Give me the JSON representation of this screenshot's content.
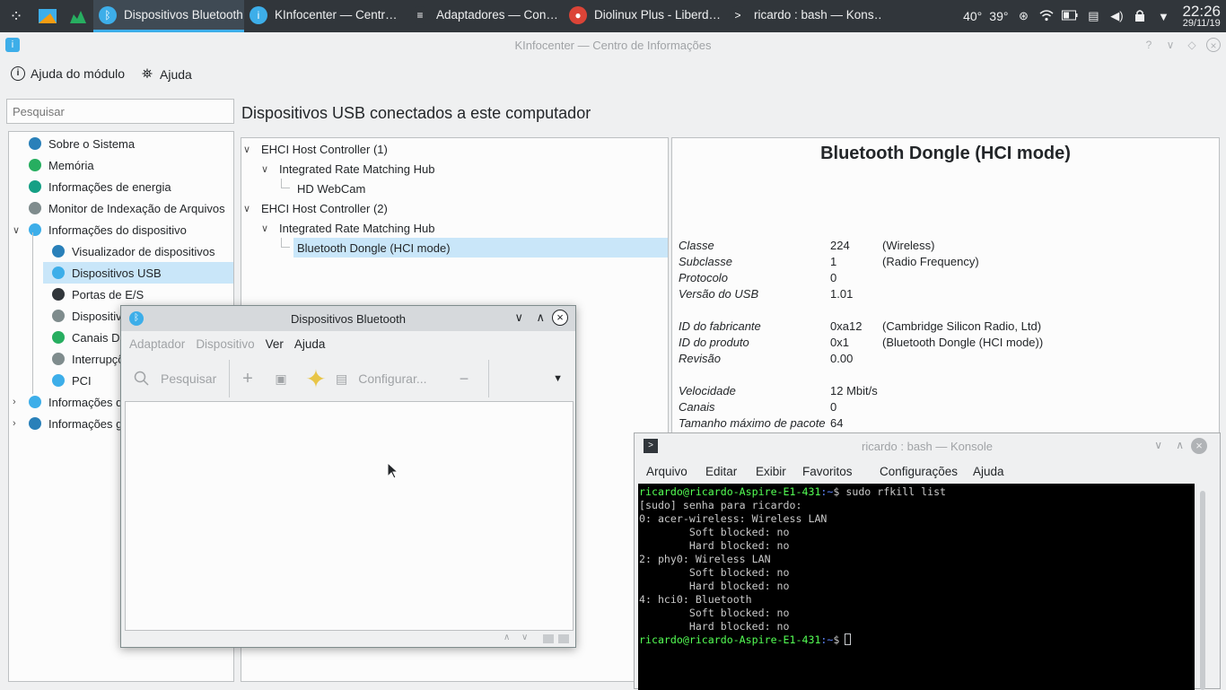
{
  "taskbar": {
    "tasks": [
      {
        "label": "Dispositivos Bluetooth",
        "icon": "bluetooth-icon",
        "active": true
      },
      {
        "label": "KInfocenter — Centr…",
        "icon": "kinfocenter-icon"
      },
      {
        "label": "Adaptadores — Con…",
        "icon": "settings-icon"
      },
      {
        "label": "Diolinux Plus - Liberd…",
        "icon": "chrome-icon"
      },
      {
        "label": "ricardo : bash — Kons…",
        "icon": "terminal-icon"
      }
    ],
    "temp1": "40°",
    "temp2": "39°",
    "time": "22:26",
    "date": "29/11/19"
  },
  "kinfo": {
    "title": "KInfocenter — Centro de Informações",
    "toolbar": {
      "module_help": "Ajuda do módulo",
      "help": "Ajuda"
    },
    "search_placeholder": "Pesquisar",
    "heading": "Dispositivos USB conectados a este computador",
    "sidebar": [
      {
        "label": "Sobre o Sistema",
        "color": "#2980b9"
      },
      {
        "label": "Memória",
        "color": "#27ae60"
      },
      {
        "label": "Informações de energia",
        "color": "#16a085"
      },
      {
        "label": "Monitor de Indexação de Arquivos",
        "color": "#7f8c8d"
      },
      {
        "label": "Informações do dispositivo",
        "color": "#3daee9"
      },
      {
        "label": "Visualizador de dispositivos",
        "color": "#2980b9"
      },
      {
        "label": "Dispositivos USB",
        "color": "#3daee9"
      },
      {
        "label": "Portas de E/S",
        "color": "#31363b"
      },
      {
        "label": "Dispositivo",
        "color": "#7f8c8d"
      },
      {
        "label": "Canais DM",
        "color": "#27ae60"
      },
      {
        "label": "Interrupçõ",
        "color": "#7f8c8d"
      },
      {
        "label": "PCI",
        "color": "#3daee9"
      },
      {
        "label": "Informações d",
        "color": "#3daee9"
      },
      {
        "label": "Informações g",
        "color": "#2980b9"
      }
    ],
    "usb_tree": [
      "EHCI Host Controller (1)",
      "Integrated Rate Matching Hub",
      "HD WebCam",
      "EHCI Host Controller (2)",
      "Integrated Rate Matching Hub",
      "Bluetooth Dongle (HCI mode)"
    ],
    "detail": {
      "title": "Bluetooth Dongle (HCI mode)",
      "rows": [
        {
          "k": "Classe",
          "v": "224",
          "x": "(Wireless)"
        },
        {
          "k": "Subclasse",
          "v": "1",
          "x": "(Radio Frequency)"
        },
        {
          "k": "Protocolo",
          "v": "0",
          "x": ""
        },
        {
          "k": "Versão do USB",
          "v": "1.01",
          "x": ""
        },
        {
          "k": "ID do fabricante",
          "v": "0xa12",
          "x": "(Cambridge Silicon Radio, Ltd)"
        },
        {
          "k": "ID do produto",
          "v": "0x1",
          "x": "(Bluetooth Dongle (HCI mode))"
        },
        {
          "k": "Revisão",
          "v": "0.00",
          "x": ""
        },
        {
          "k": "Velocidade",
          "v": "12 Mbit/s",
          "x": ""
        },
        {
          "k": "Canais",
          "v": "0",
          "x": ""
        },
        {
          "k": "Tamanho máximo de pacote",
          "v": "64",
          "x": ""
        }
      ]
    }
  },
  "bluetooth": {
    "title": "Dispositivos Bluetooth",
    "menu": {
      "adapter": "Adaptador",
      "device": "Dispositivo",
      "view": "Ver",
      "help": "Ajuda"
    },
    "toolbar": {
      "search": "Pesquisar",
      "configure": "Configurar..."
    }
  },
  "konsole": {
    "title": "ricardo : bash — Konsole",
    "menu": [
      "Arquivo",
      "Editar",
      "Exibir",
      "Favoritos",
      "Configurações",
      "Ajuda"
    ],
    "prompt_user": "ricardo@ricardo-Aspire-E1-431",
    "prompt_path": ":~",
    "prompt_sign": "$",
    "command": " sudo rfkill list",
    "output": [
      "[sudo] senha para ricardo:",
      "0: acer-wireless: Wireless LAN",
      "        Soft blocked: no",
      "        Hard blocked: no",
      "2: phy0: Wireless LAN",
      "        Soft blocked: no",
      "        Hard blocked: no",
      "4: hci0: Bluetooth",
      "        Soft blocked: no",
      "        Hard blocked: no"
    ]
  }
}
